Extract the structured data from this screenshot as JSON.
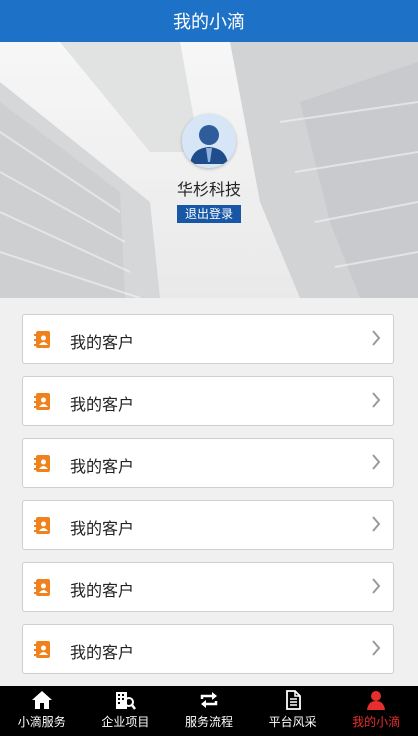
{
  "header": {
    "title": "我的小滴"
  },
  "profile": {
    "company": "华杉科技",
    "logout_label": "退出登录",
    "avatar": "user-avatar-icon"
  },
  "menu": {
    "items": [
      {
        "label": "我的客户",
        "icon": "contacts-book-icon"
      },
      {
        "label": "我的客户",
        "icon": "contacts-book-icon"
      },
      {
        "label": "我的客户",
        "icon": "contacts-book-icon"
      },
      {
        "label": "我的客户",
        "icon": "contacts-book-icon"
      },
      {
        "label": "我的客户",
        "icon": "contacts-book-icon"
      },
      {
        "label": "我的客户",
        "icon": "contacts-book-icon"
      }
    ]
  },
  "tabbar": {
    "tabs": [
      {
        "label": "小滴服务",
        "icon": "home-icon",
        "active": false
      },
      {
        "label": "企业项目",
        "icon": "building-search-icon",
        "active": false
      },
      {
        "label": "服务流程",
        "icon": "refresh-arrows-icon",
        "active": false
      },
      {
        "label": "平台风采",
        "icon": "document-icon",
        "active": false
      },
      {
        "label": "我的小滴",
        "icon": "user-icon",
        "active": true
      }
    ]
  },
  "colors": {
    "header_bg": "#1d72c7",
    "logout_bg": "#1757a6",
    "active_tab": "#e62e2e",
    "item_icon": "#f0821e"
  }
}
